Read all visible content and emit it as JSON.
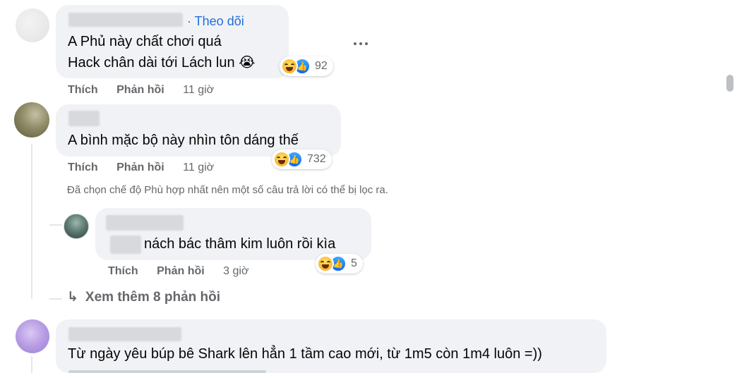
{
  "comments": [
    {
      "follow_label": "· Theo dõi",
      "lines": [
        "A Phủ này chất chơi quá",
        "Hack chân dài tới Lách lun 😭"
      ],
      "reaction_count": "92",
      "like_label": "Thích",
      "reply_label": "Phản hồi",
      "time": "11 giờ"
    },
    {
      "lines": [
        "A bình mặc bộ này nhìn tôn dáng thế"
      ],
      "reaction_count": "732",
      "like_label": "Thích",
      "reply_label": "Phản hồi",
      "time": "11 giờ"
    }
  ],
  "filter_notice": "Đã chọn chế độ Phù hợp nhất nên một số câu trả lời có thể bị lọc ra.",
  "reply": {
    "text": "nách bác thâm kim luôn rồi kìa",
    "reaction_count": "5",
    "like_label": "Thích",
    "reply_label": "Phản hồi",
    "time": "3 giờ"
  },
  "see_more": {
    "arrow": "↳",
    "label": "Xem thêm 8 phản hồi"
  },
  "last_comment": {
    "text": "Từ ngày yêu búp bê Shark lên hẳn 1 tầm cao mới, từ 1m5 còn 1m4 luôn =))"
  },
  "icons": {
    "more": "more-options-icon",
    "haha": "haha-reaction-icon",
    "like": "like-reaction-icon"
  },
  "colors": {
    "bubble": "#f0f2f5",
    "link": "#216fdb",
    "secondary_text": "#65676b",
    "like_blue": "#0866ff",
    "haha_yellow": "#f7b125"
  }
}
